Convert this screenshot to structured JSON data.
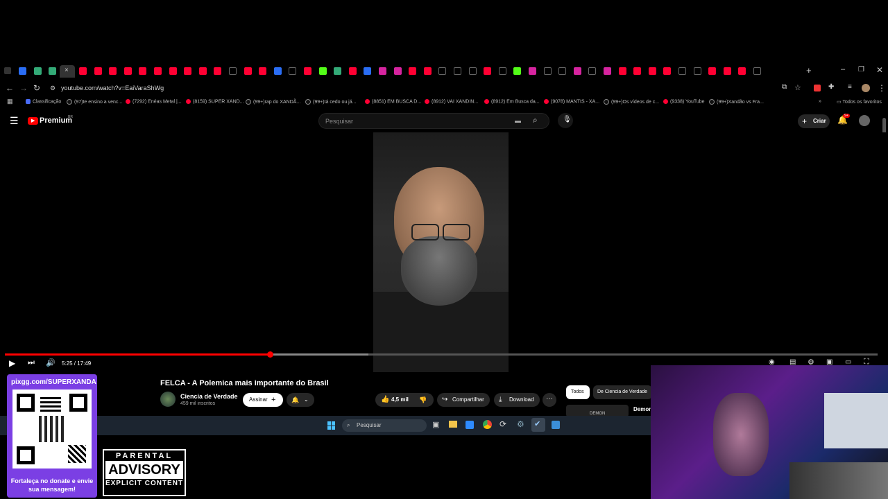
{
  "browser": {
    "url": "youtube.com/watch?v=EaiVaraShWg",
    "bookmarks": [
      {
        "label": "Classificação",
        "type": "cl"
      },
      {
        "label": "(97)te ensino a venc...",
        "type": "tt"
      },
      {
        "label": "(7292) Enéas Metal |...",
        "type": "yt"
      },
      {
        "label": "(8159) SUPER XAND...",
        "type": "yt"
      },
      {
        "label": "(99+)rap do XANDÃ...",
        "type": "tt"
      },
      {
        "label": "(99+)tá cedo ou já...",
        "type": "tt"
      },
      {
        "label": "(8851) EM BUSCA D...",
        "type": "yt"
      },
      {
        "label": "(8912) VAI XANDIN...",
        "type": "yt"
      },
      {
        "label": "(8912) Em Busca da...",
        "type": "yt"
      },
      {
        "label": "(9078) MANTIS - XA...",
        "type": "yt"
      },
      {
        "label": "(99+)Os vídeos de c...",
        "type": "tt"
      },
      {
        "label": "(9338) YouTube",
        "type": "yt"
      },
      {
        "label": "(99+)Xandão vs Fra...",
        "type": "tt"
      }
    ],
    "all_bookmarks": "Todos os favoritos"
  },
  "youtube": {
    "logo": "Premium",
    "logo_badge": "BR",
    "search_placeholder": "Pesquisar",
    "create_label": "Criar",
    "notif_count": "9+",
    "time": "5:25 / 17:49",
    "progress_fraction": 0.304,
    "video_title": "FELCA - A Polemica mais importante do Brasil",
    "channel_name": "Ciencia de Verdade",
    "subscribers": "459 mil inscritos",
    "subscribe_label": "Assinar",
    "likes": "4,5 mil",
    "share_label": "Compartilhar",
    "download_label": "Download",
    "chip_all": "Todos",
    "chip_channel": "De Ciencia de Verdade",
    "rec_title": "Demon",
    "rec_thumb_text": "DEMON"
  },
  "taskbar": {
    "search_placeholder": "Pesquisar"
  },
  "overlay": {
    "pix_url": "pixgg.com/SUPERXANDA",
    "pix_message": "Fortaleça no donate e envie sua mensagem!",
    "advisory_top": "PARENTAL",
    "advisory_mid": "ADVISORY",
    "advisory_bottom": "EXPLICIT CONTENT"
  },
  "colors": {
    "accent": "#ff0000",
    "pix_bg": "#7b3fe4"
  }
}
